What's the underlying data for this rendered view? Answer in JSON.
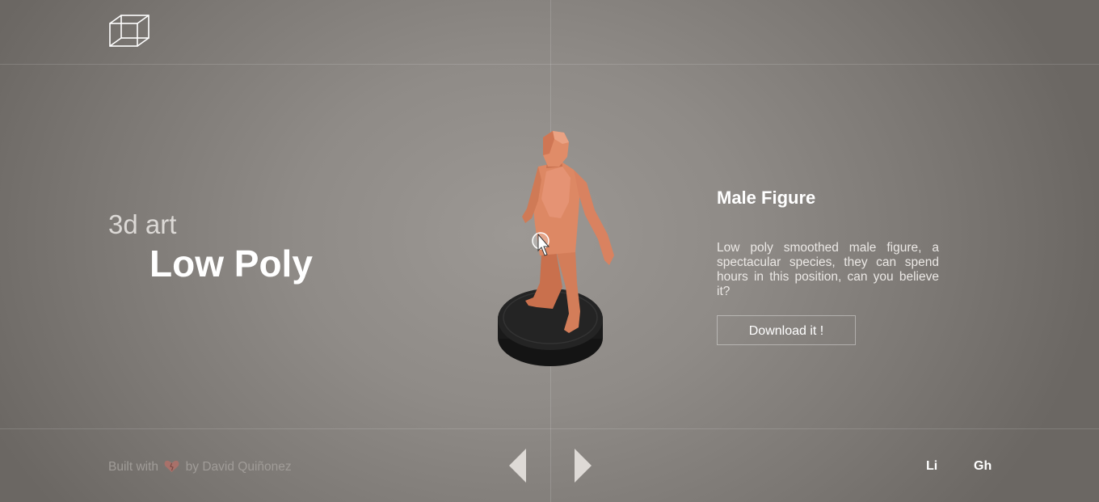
{
  "header": {
    "logo_icon": "wireframe-cube-icon"
  },
  "hero": {
    "subtitle": "3d art",
    "title": "Low Poly"
  },
  "viewer": {
    "model_name": "Male Figure",
    "model_icon": "low-poly-male-figure",
    "cursor_icon": "hand-pointer-icon",
    "colors": {
      "figure": "#d98662",
      "base": "#1e1e1e"
    }
  },
  "product": {
    "name": "Male Figure",
    "description": "Low poly smoothed male figure, a spectacular species, they can spend hours in this position, can you believe it?",
    "download_label": "Download it !"
  },
  "footer": {
    "credit_prefix": "Built with",
    "credit_icon": "heart-icon",
    "credit_suffix": "by David Quiñonez",
    "prev_icon": "triangle-left-icon",
    "next_icon": "triangle-right-icon",
    "social": [
      {
        "label": "Li"
      },
      {
        "label": "Gh"
      }
    ]
  }
}
